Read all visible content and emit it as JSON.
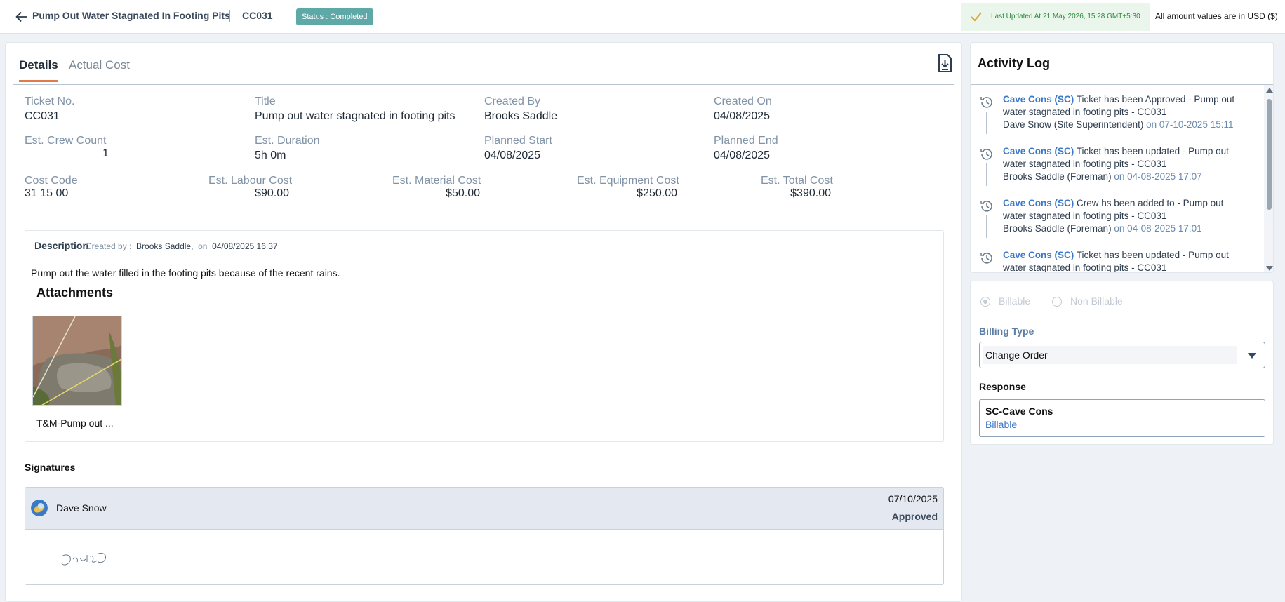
{
  "header": {
    "title": "Pump Out Water Stagnated In Footing Pits",
    "code": "CC031",
    "status": "Status : Completed",
    "last_updated": "Last Updated At 21 May 2026, 15:28 GMT+5:30",
    "currency_note": "All amount values are in USD ($)"
  },
  "tabs": [
    "Details",
    "Actual Cost"
  ],
  "fields": {
    "ticket_no": {
      "label": "Ticket No.",
      "value": "CC031"
    },
    "title": {
      "label": "Title",
      "value": "Pump out water stagnated in footing pits"
    },
    "created_by": {
      "label": "Created By",
      "value": "Brooks Saddle"
    },
    "created_on": {
      "label": "Created On",
      "value": "04/08/2025"
    },
    "crew_count": {
      "label": "Est. Crew Count",
      "value": "1"
    },
    "duration": {
      "label": "Est. Duration",
      "value": "5h 0m"
    },
    "planned_start": {
      "label": "Planned Start",
      "value": "04/08/2025"
    },
    "planned_end": {
      "label": "Planned End",
      "value": "04/08/2025"
    },
    "cost_code": {
      "label": "Cost Code",
      "value": "31 15 00"
    },
    "labour_cost": {
      "label": "Est. Labour Cost",
      "value": "$90.00"
    },
    "material_cost": {
      "label": "Est. Material Cost",
      "value": "$50.00"
    },
    "equipment_cost": {
      "label": "Est. Equipment Cost",
      "value": "$250.00"
    },
    "total_cost": {
      "label": "Est. Total Cost",
      "value": "$390.00"
    }
  },
  "description": {
    "title": "Description",
    "created_by_label": "Created by :",
    "created_by": "Brooks Saddle,",
    "on_label": "on",
    "created_on": "04/08/2025 16:37",
    "text": "Pump out the water filled in the footing pits because of the recent rains.",
    "attachments_title": "Attachments",
    "attachment_name": "T&M-Pump out ..."
  },
  "signatures": {
    "title": "Signatures",
    "name": "Dave Snow",
    "date": "07/10/2025",
    "status": "Approved"
  },
  "activity": {
    "title": "Activity Log",
    "entries": [
      {
        "who": "Cave Cons (SC)",
        "text": " Ticket has been Approved - Pump out water stagnated in footing pits - CC031",
        "by": "Dave Snow (Site Superintendent)",
        "when": " on 07-10-2025 15:11"
      },
      {
        "who": "Cave Cons (SC)",
        "text": " Ticket has been updated - Pump out water stagnated in footing pits - CC031",
        "by": "Brooks Saddle (Foreman)",
        "when": " on 04-08-2025 17:07"
      },
      {
        "who": "Cave Cons (SC)",
        "text": " Crew hs been added to - Pump out water stagnated in footing pits - CC031",
        "by": "Brooks Saddle (Foreman)",
        "when": " on 04-08-2025 17:01"
      },
      {
        "who": "Cave Cons (SC)",
        "text": " Ticket has been updated - Pump out water stagnated in footing pits - CC031",
        "by": "",
        "when": ""
      }
    ]
  },
  "billing": {
    "option_billable": "Billable",
    "option_non_billable": "Non Billable",
    "type_label": "Billing Type",
    "type_value": "Change Order",
    "response_label": "Response",
    "response_name": "SC-Cave Cons",
    "response_value": "Billable"
  },
  "colors": {
    "accent": "#e07a4b",
    "status_badge": "#5fa8a8",
    "link_blue": "#3a78c9",
    "label_gray": "#8193a6"
  },
  "icons": [
    "back-arrow-icon",
    "check-icon",
    "download-icon",
    "history-icon",
    "avatar-icon",
    "caret-down-icon"
  ]
}
